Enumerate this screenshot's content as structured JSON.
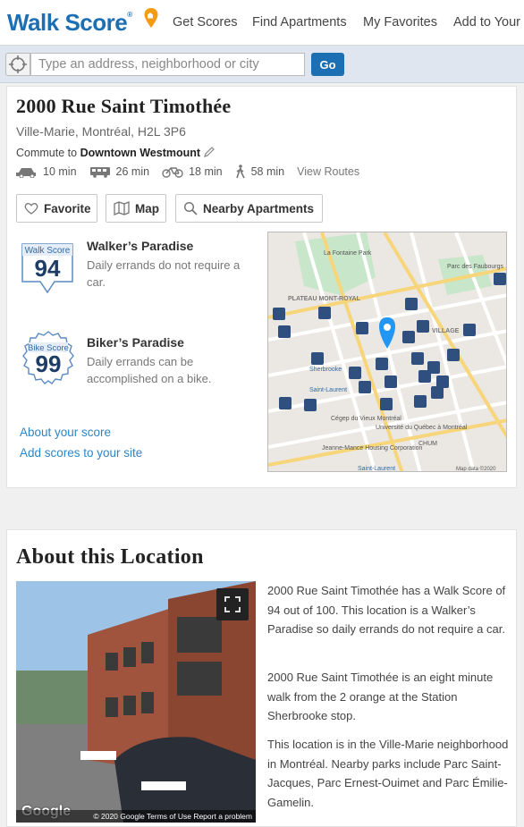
{
  "brand": {
    "name": "Walk Score",
    "reg": "®",
    "color": "#1c6fb3",
    "pin_color": "#f39c12"
  },
  "nav": {
    "items": [
      "Get Scores",
      "Find Apartments",
      "My Favorites",
      "Add to Your S"
    ]
  },
  "search": {
    "placeholder": "Type an address, neighborhood or city",
    "go_label": "Go"
  },
  "location": {
    "title": "2000 Rue Saint Timothée",
    "address": "Ville-Marie, Montréal, H2L 3P6",
    "commute_prefix": "Commute to ",
    "commute_target": "Downtown Westmount",
    "modes": [
      {
        "icon": "car-icon",
        "time": "10 min"
      },
      {
        "icon": "bus-icon",
        "time": "26 min"
      },
      {
        "icon": "bike-icon",
        "time": "18 min"
      },
      {
        "icon": "walk-icon",
        "time": "58 min"
      }
    ],
    "view_routes": "View Routes"
  },
  "actions": {
    "favorite": "Favorite",
    "map": "Map",
    "nearby": "Nearby Apartments"
  },
  "scores": {
    "walk": {
      "badge_label": "Walk Score",
      "value": "94",
      "heading": "Walker’s Paradise",
      "description": "Daily errands do not require a car."
    },
    "bike": {
      "badge_label": "Bike Score",
      "value": "99",
      "heading": "Biker’s Paradise",
      "description": "Daily errands can be accomplished on a bike."
    }
  },
  "links": {
    "about": "About your score",
    "add": "Add scores to your site"
  },
  "map": {
    "labels": [
      "La Fontaine Park",
      "PLATEAU MONT-ROYAL",
      "Parc des Faubourgs",
      "VILLAGE",
      "Sherbrooke",
      "Saint-Laurent",
      "Cégep du Vieux Montréal",
      "Université du Québec à Montréal",
      "CHUM",
      "Jeanne-Mance Housing Corporation",
      "Saint-Laurent",
      "Map data ©2020"
    ],
    "pin_color": "#2196f3"
  },
  "about": {
    "heading": "About this Location",
    "paragraphs": [
      "2000 Rue Saint Timothée has a Walk Score of 94 out of 100. This location is a Walker’s Paradise so daily errands do not require a car.",
      "2000 Rue Saint Timothée is an eight minute walk from the 2 orange at the Station Sherbrooke stop.",
      "This location is in the Ville-Marie neighborhood in Montréal. Nearby parks include Parc Saint-Jacques, Parc Ernest-Ouimet and Parc Émilie-Gamelin."
    ],
    "streetview_google": "Google",
    "streetview_footer": "© 2020 Google   Terms of Use   Report a problem"
  }
}
